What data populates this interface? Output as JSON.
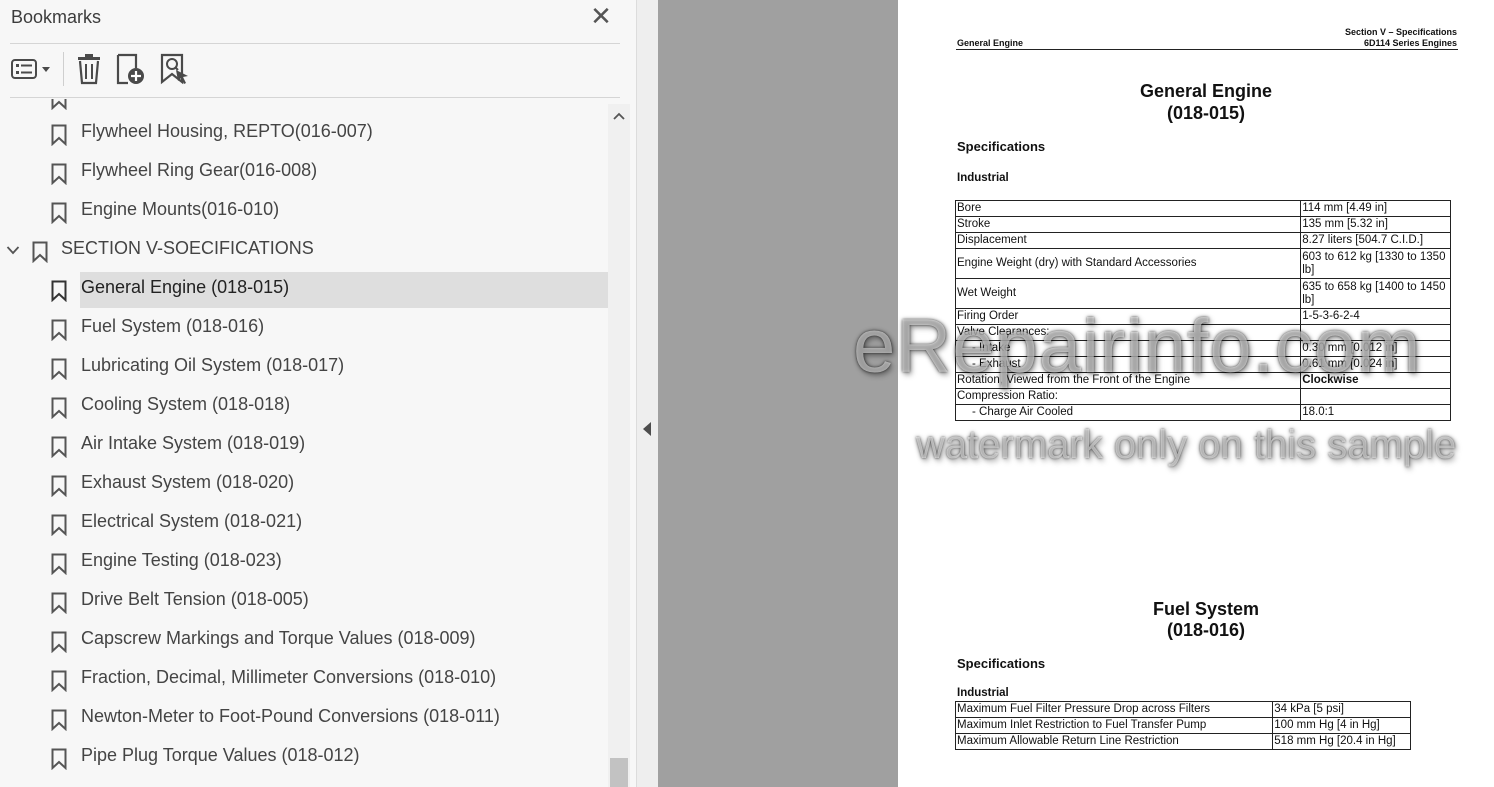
{
  "panel": {
    "title": "Bookmarks",
    "close_glyph": "✕",
    "toolbar": {
      "options_icon": "list-options-icon",
      "delete_icon": "trash-icon",
      "add_icon": "add-bookmark-icon",
      "find_icon": "find-bookmark-icon"
    }
  },
  "bookmarks": [
    {
      "label": "Flywheel Housing, REPTO(016-007)",
      "level": 2
    },
    {
      "label": "Flywheel Ring Gear(016-008)",
      "level": 2
    },
    {
      "label": "Engine Mounts(016-010)",
      "level": 2
    },
    {
      "label": "SECTION V-SOECIFICATIONS",
      "level": 1,
      "expanded": true
    },
    {
      "label": "General Engine (018-015)",
      "level": 2,
      "selected": true
    },
    {
      "label": "Fuel System (018-016)",
      "level": 2
    },
    {
      "label": "Lubricating Oil System (018-017)",
      "level": 2
    },
    {
      "label": "Cooling System (018-018)",
      "level": 2
    },
    {
      "label": "Air Intake System (018-019)",
      "level": 2
    },
    {
      "label": "Exhaust System (018-020)",
      "level": 2
    },
    {
      "label": "Electrical System (018-021)",
      "level": 2
    },
    {
      "label": "Engine Testing (018-023)",
      "level": 2
    },
    {
      "label": "Drive Belt Tension (018-005)",
      "level": 2
    },
    {
      "label": "Capscrew Markings and Torque Values (018-009)",
      "level": 2
    },
    {
      "label": "Fraction, Decimal, Millimeter Conversions (018-010)",
      "level": 2
    },
    {
      "label": "Newton-Meter to Foot-Pound Conversions (018-011)",
      "level": 2
    },
    {
      "label": "Pipe Plug Torque Values (018-012)",
      "level": 2
    }
  ],
  "document": {
    "header_left": "General Engine",
    "header_right_1": "Section V – Specifications",
    "header_right_2": "6D114 Series Engines",
    "section1": {
      "title_1": "General Engine",
      "title_2": "(018-015)",
      "spec_heading": "Specifications",
      "subheading": "Industrial",
      "rows": [
        {
          "name": "Bore",
          "value": "114 mm [4.49 in]"
        },
        {
          "name": "Stroke",
          "value": "135 mm [5.32 in]"
        },
        {
          "name": "Displacement",
          "value": "8.27 liters [504.7 C.I.D.]"
        },
        {
          "name": "Engine Weight (dry) with Standard Accessories",
          "value": "603 to 612 kg [1330 to 1350 lb]"
        },
        {
          "name": "Wet Weight",
          "value": "635 to 658 kg [1400 to 1450 lb]"
        },
        {
          "name": "Firing Order",
          "value": "1-5-3-6-2-4"
        },
        {
          "name": "Valve Clearances:",
          "value": ""
        },
        {
          "name": "- Intake",
          "value": "0.30 mm [0.012 in]",
          "indent": true
        },
        {
          "name": "- Exhaust",
          "value": "0.61 mm [0.024 in]",
          "indent": true
        },
        {
          "name": "Rotation, Viewed from the Front of the Engine",
          "value": "Clockwise",
          "bold": true
        },
        {
          "name": "Compression Ratio:",
          "value": ""
        },
        {
          "name": "- Charge Air Cooled",
          "value": "18.0:1",
          "indent": true
        }
      ]
    },
    "section2": {
      "title_1": "Fuel System",
      "title_2": "(018-016)",
      "spec_heading": "Specifications",
      "subheading": "Industrial",
      "rows": [
        {
          "name": "Maximum Fuel Filter Pressure Drop across Filters",
          "value": "34 kPa [5 psi]"
        },
        {
          "name": "Maximum Inlet Restriction to Fuel Transfer Pump",
          "value": "100 mm Hg [4 in Hg]"
        },
        {
          "name": "Maximum Allowable Return Line Restriction",
          "value": "518 mm Hg [20.4 in Hg]"
        }
      ]
    }
  },
  "watermark": {
    "main": "eRepairinfo.com",
    "sub": "watermark only on this sample"
  }
}
